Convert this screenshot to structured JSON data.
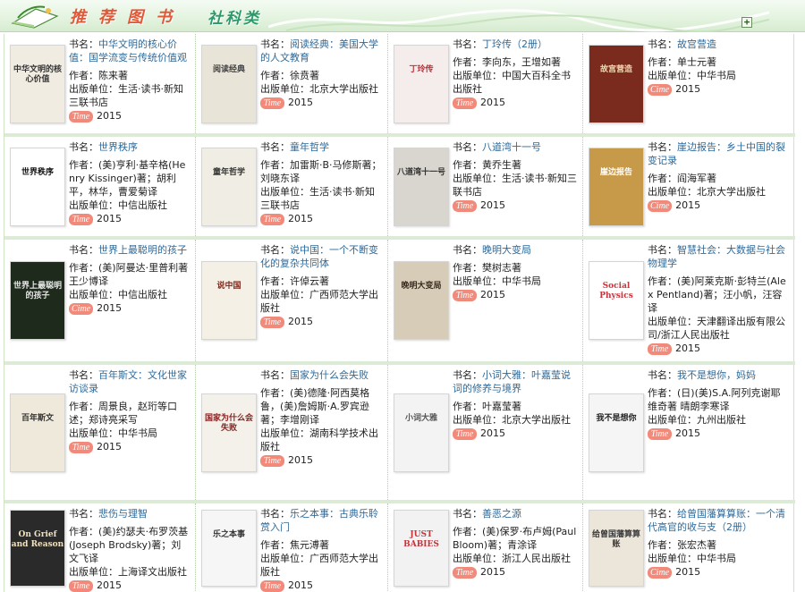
{
  "header": {
    "title": "推荐图书",
    "subtitle": "社科类",
    "expand_icon": "+"
  },
  "time_label": "Time",
  "time_label_alt": "Cime",
  "labels": {
    "title": "书名：",
    "author": "作者：",
    "publisher": "出版单位："
  },
  "books": [
    {
      "title": "中华文明的核心价值：国学流变与传统价值观",
      "author": "陈来著",
      "publisher": "生活·读书·新知三联书店",
      "year": "2015",
      "badge": "Time",
      "cover": {
        "text": "中华文明的核心价值",
        "bg": "#f1ece2",
        "fg": "#333333"
      }
    },
    {
      "title": "阅读经典：美国大学的人文教育",
      "author": "徐贲著",
      "publisher": "北京大学出版社",
      "year": "2015",
      "badge": "Time",
      "cover": {
        "text": "阅读经典",
        "bg": "#e8e4d8",
        "fg": "#444444"
      }
    },
    {
      "title": "丁玲传（2册）",
      "author": "李向东，王增如著",
      "publisher": "中国大百科全书出版社",
      "year": "2015",
      "badge": "Time",
      "cover": {
        "text": "丁玲传",
        "bg": "#f5ecec",
        "fg": "#b8333a"
      }
    },
    {
      "title": "故宫营造",
      "author": "单士元著",
      "publisher": "中华书局",
      "year": "2015",
      "badge": "Cime",
      "cover": {
        "text": "故宫营造",
        "bg": "#7b2a1e",
        "fg": "#f0d8b0"
      }
    },
    {
      "title": "世界秩序",
      "author": "(美)亨利·基辛格(Henry Kissinger)著；胡利平，林华，曹爱菊译",
      "publisher": "中信出版社",
      "year": "2015",
      "badge": "Time",
      "cover": {
        "text": "世界秩序",
        "bg": "#ffffff",
        "fg": "#111111"
      }
    },
    {
      "title": "童年哲学",
      "author": "加雷斯·B·马修斯著；刘晓东译",
      "publisher": "生活·读书·新知三联书店",
      "year": "2015",
      "badge": "Time",
      "cover": {
        "text": "童年哲学",
        "bg": "#f0eee4",
        "fg": "#333333"
      }
    },
    {
      "title": "八道湾十一号",
      "author": "黄乔生著",
      "publisher": "生活·读书·新知三联书店",
      "year": "2015",
      "badge": "Time",
      "cover": {
        "text": "八道湾十一号",
        "bg": "#d9d6d0",
        "fg": "#333333"
      }
    },
    {
      "title": "崖边报告：乡土中国的裂变记录",
      "author": "阎海军著",
      "publisher": "北京大学出版社",
      "year": "2015",
      "badge": "Cime",
      "cover": {
        "text": "崖边报告",
        "bg": "#c79a4a",
        "fg": "#ffffff"
      }
    },
    {
      "title": "世界上最聪明的孩子",
      "author": "(美)阿曼达·里普利著 王少博译",
      "publisher": "中信出版社",
      "year": "2015",
      "badge": "Cime",
      "cover": {
        "text": "世界上最聪明的孩子",
        "bg": "#1e2a1c",
        "fg": "#e6e6e6"
      }
    },
    {
      "title": "说中国：一个不断变化的复杂共同体",
      "author": "许倬云著",
      "publisher": "广西师范大学出版社",
      "year": "2015",
      "badge": "Time",
      "cover": {
        "text": "说中国",
        "bg": "#f4f0e6",
        "fg": "#7a2a1e"
      }
    },
    {
      "title": "晚明大变局",
      "author": "樊树志著",
      "publisher": "中华书局",
      "year": "2015",
      "badge": "Time",
      "cover": {
        "text": "晚明大变局",
        "bg": "#d7ccb8",
        "fg": "#3a2a1e"
      }
    },
    {
      "title": "智慧社会：大数据与社会物理学",
      "author": "(美)阿莱克斯·彭特兰(Alex Pentland)著；汪小帆，汪容译",
      "publisher": "天津翻译出版有限公司/浙江人民出版社",
      "year": "2015",
      "badge": "Time",
      "cover": {
        "text": "Social Physics",
        "bg": "#ffffff",
        "fg": "#c8343c"
      }
    },
    {
      "title": "百年斯文：文化世家访谈录",
      "author": "周景良，赵珩等口述；郑诗亮采写",
      "publisher": "中华书局",
      "year": "2015",
      "badge": "Time",
      "cover": {
        "text": "百年斯文",
        "bg": "#efe9dc",
        "fg": "#333333"
      }
    },
    {
      "title": "国家为什么会失败",
      "author": "(美)德隆·阿西莫格鲁，(美)詹姆斯·A.罗宾逊著；李增刚译",
      "publisher": "湖南科学技术出版社",
      "year": "2015",
      "badge": "Time",
      "cover": {
        "text": "国家为什么会失败",
        "bg": "#f4f1ea",
        "fg": "#8a1e1e"
      }
    },
    {
      "title": "小词大雅：叶嘉莹说词的修养与境界",
      "author": "叶嘉莹著",
      "publisher": "北京大学出版社",
      "year": "2015",
      "badge": "Time",
      "cover": {
        "text": "小词大雅",
        "bg": "#f3f3f3",
        "fg": "#555555"
      }
    },
    {
      "title": "我不是想你，妈妈",
      "author": "(日)(美)S.A.阿列克谢耶维奇著 晴朗李寒译",
      "publisher": "九州出版社",
      "year": "2015",
      "badge": "Time",
      "cover": {
        "text": "我不是想你",
        "bg": "#f5f5f5",
        "fg": "#222222"
      }
    },
    {
      "title": "悲伤与理智",
      "author": "(美)约瑟夫·布罗茨基(Joseph Brodsky)著；刘文飞译",
      "publisher": "上海译文出版社",
      "year": "2015",
      "badge": "Time",
      "cover": {
        "text": "On Grief and Reason",
        "bg": "#2a2a2a",
        "fg": "#f0e2c0"
      }
    },
    {
      "title": "乐之本事：古典乐聆赏入门",
      "author": "焦元溥著",
      "publisher": "广西师范大学出版社",
      "year": "2015",
      "badge": "Time",
      "cover": {
        "text": "乐之本事",
        "bg": "#f6f6f6",
        "fg": "#333333"
      }
    },
    {
      "title": "善恶之源",
      "author": "(美)保罗·布卢姆(Paul Bloom)著；青涂译",
      "publisher": "浙江人民出版社",
      "year": "2015",
      "badge": "Time",
      "cover": {
        "text": "JUST BABIES",
        "bg": "#f2f2f2",
        "fg": "#c8343c"
      }
    },
    {
      "title": "给曾国藩算算账：一个清代高官的收与支（2册）",
      "author": "张宏杰著",
      "publisher": "中华书局",
      "year": "2015",
      "badge": "Cime",
      "cover": {
        "text": "给曾国藩算算账",
        "bg": "#ece6da",
        "fg": "#3a3a3a"
      }
    }
  ]
}
